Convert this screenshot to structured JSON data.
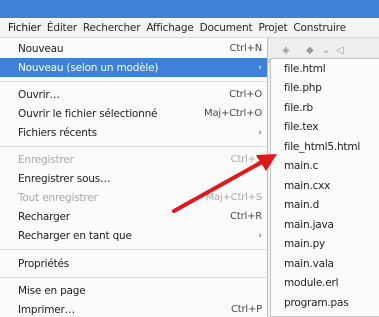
{
  "menubar": {
    "items": [
      "Fichier",
      "Éditer",
      "Rechercher",
      "Affichage",
      "Document",
      "Projet",
      "Construire"
    ]
  },
  "file_menu": {
    "items": [
      {
        "label": "Nouveau",
        "accel": "Ctrl+N"
      },
      {
        "label": "Nouveau (selon un modèle)",
        "accel": "›"
      },
      {
        "label": "Ouvrir…",
        "accel": "Ctrl+O"
      },
      {
        "label": "Ouvrir le fichier sélectionné",
        "accel": "Maj+Ctrl+O"
      },
      {
        "label": "Fichiers récents",
        "accel": "›"
      },
      {
        "label": "Enregistrer",
        "accel": "Ctrl+S"
      },
      {
        "label": "Enregistrer sous…",
        "accel": ""
      },
      {
        "label": "Tout enregistrer",
        "accel": "Maj+Ctrl+S"
      },
      {
        "label": "Recharger",
        "accel": "Ctrl+R"
      },
      {
        "label": "Recharger en tant que",
        "accel": "›"
      },
      {
        "label": "Propriétés",
        "accel": ""
      },
      {
        "label": "Mise en page",
        "accel": ""
      },
      {
        "label": "Imprimer…",
        "accel": "Ctrl+P"
      }
    ]
  },
  "template_submenu": {
    "items": [
      "file.html",
      "file.php",
      "file.rb",
      "file.tex",
      "file_html5.html",
      "main.c",
      "main.cxx",
      "main.d",
      "main.java",
      "main.py",
      "main.vala",
      "module.erl",
      "program.pas"
    ]
  },
  "colors": {
    "highlight": "#3d82d6",
    "annotation_arrow": "#e3161b"
  }
}
